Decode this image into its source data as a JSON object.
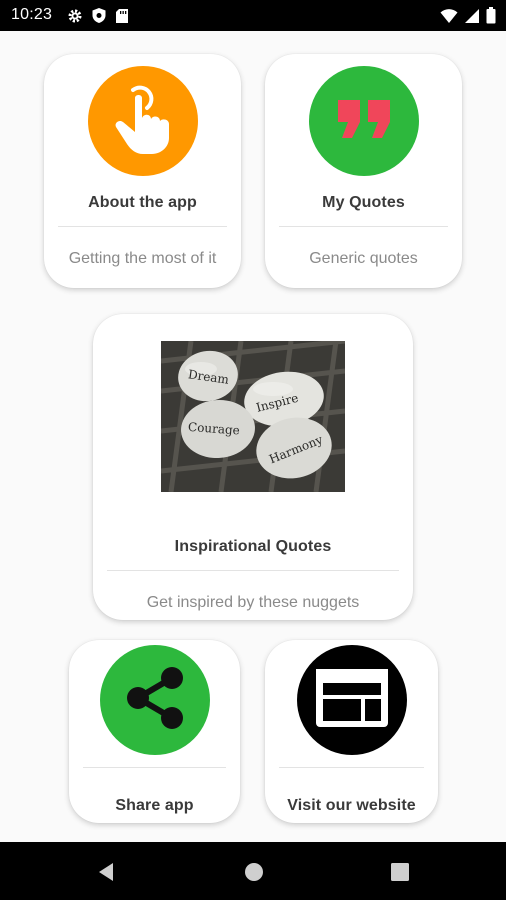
{
  "status_bar": {
    "time": "10:23",
    "left_icons": [
      "gear-icon",
      "shield-icon",
      "sd-card-icon"
    ],
    "right_icons": [
      "wifi-icon",
      "signal-icon",
      "battery-icon"
    ]
  },
  "cards": {
    "about": {
      "title": "About the app",
      "subtitle": "Getting the most of it",
      "icon": "touch-hand-icon",
      "color": "#FF9800"
    },
    "quotes": {
      "title": "My Quotes",
      "subtitle": "Generic quotes",
      "icon": "quote-marks-icon",
      "color": "#2DB83D",
      "icon_color": "#F0465A"
    },
    "inspirational": {
      "title": "Inspirational Quotes",
      "subtitle": "Get inspired by these nuggets",
      "image_words": [
        "Dream",
        "Inspire",
        "Courage",
        "Harmony"
      ]
    },
    "share": {
      "title": "Share app",
      "icon": "share-icon",
      "color": "#2DB83D"
    },
    "website": {
      "title": "Visit our website",
      "icon": "web-page-icon",
      "color": "#000000"
    }
  },
  "nav_bar": {
    "buttons": [
      "back-icon",
      "home-icon",
      "recents-icon"
    ]
  }
}
